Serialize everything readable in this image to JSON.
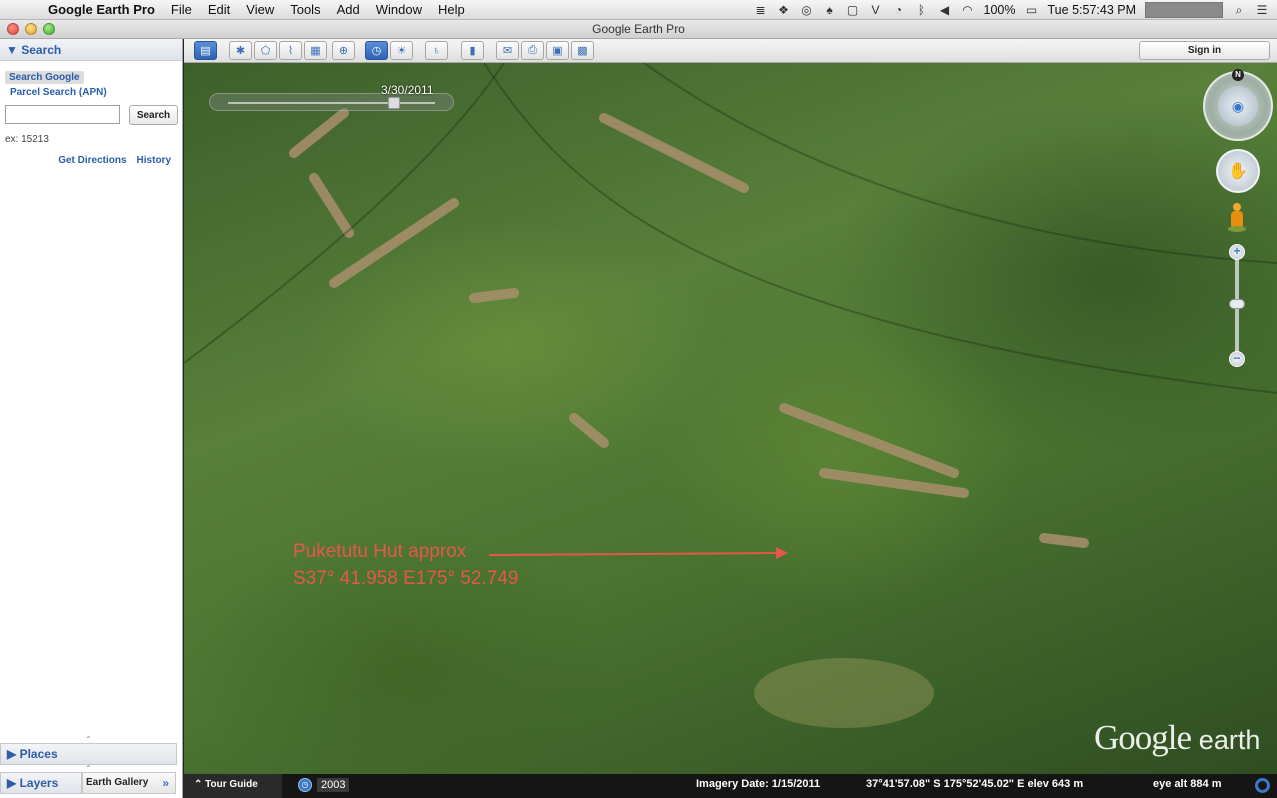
{
  "menubar": {
    "app_name": "Google Earth Pro",
    "items": [
      "File",
      "Edit",
      "View",
      "Tools",
      "Add",
      "Window",
      "Help"
    ],
    "battery": "100%",
    "clock": "Tue 5:57:43 PM"
  },
  "window": {
    "title": "Google Earth Pro"
  },
  "sidebar": {
    "search_header": "Search",
    "tab_search_google": "Search Google",
    "tab_parcel": "Parcel Search (APN)",
    "search_input_value": "",
    "search_button": "Search",
    "example": "ex: 15213",
    "get_directions": "Get Directions",
    "history": "History",
    "places": "Places",
    "layers": "Layers",
    "earth_gallery": "Earth Gallery"
  },
  "toolbar": {
    "sign_in": "Sign in",
    "buttons": [
      {
        "icon": "sidebar-icon",
        "glyph": "▤"
      },
      {
        "icon": "placemark-icon",
        "glyph": "✱"
      },
      {
        "icon": "polygon-icon",
        "glyph": "⬠"
      },
      {
        "icon": "path-icon",
        "glyph": "⌇"
      },
      {
        "icon": "overlay-icon",
        "glyph": "▦"
      },
      {
        "icon": "tour-icon",
        "glyph": "⊕"
      },
      {
        "icon": "historical-imagery-icon",
        "glyph": "◷"
      },
      {
        "icon": "sunlight-icon",
        "glyph": "☀"
      },
      {
        "icon": "planets-icon",
        "glyph": "♄"
      },
      {
        "icon": "ruler-icon",
        "glyph": "▮"
      },
      {
        "icon": "email-icon",
        "glyph": "✉"
      },
      {
        "icon": "print-icon",
        "glyph": "⎙"
      },
      {
        "icon": "save-image-icon",
        "glyph": "▣"
      },
      {
        "icon": "maps-icon",
        "glyph": "▩"
      }
    ]
  },
  "map": {
    "time_slider_date": "3/30/2011",
    "annotation_line1": "Puketutu Hut approx",
    "annotation_line2": "S37° 41.958 E175° 52.749",
    "logo_google": "Google",
    "logo_earth": "earth",
    "compass_north": "N"
  },
  "status": {
    "tour_guide": "Tour Guide",
    "year": "2003",
    "imagery_date": "Imagery Date: 1/15/2011",
    "coords": "37°41'57.08\" S  175°52'45.02\" E  elev   643 m",
    "eye_alt": "eye alt    884 m"
  },
  "colors": {
    "accent": "#2b5da8",
    "annotation": "#e4584a"
  }
}
